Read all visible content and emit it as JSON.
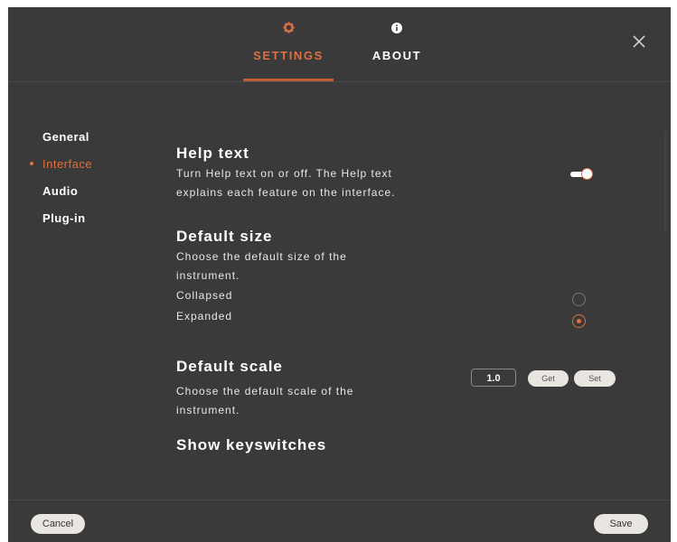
{
  "tabs": {
    "settings": {
      "label": "SETTINGS",
      "icon": "gear-icon"
    },
    "about": {
      "label": "ABOUT",
      "icon": "info-icon"
    }
  },
  "close_icon": "close-icon",
  "sidebar": {
    "items": [
      {
        "label": "General",
        "active": false
      },
      {
        "label": "Interface",
        "active": true
      },
      {
        "label": "Audio",
        "active": false
      },
      {
        "label": "Plug-in",
        "active": false
      }
    ]
  },
  "sections": {
    "help_text": {
      "title": "Help text",
      "desc_line1": "Turn Help text on or off. The Help text",
      "desc_line2": "explains each feature on the interface.",
      "enabled": true
    },
    "default_size": {
      "title": "Default size",
      "desc_line1": "Choose the default size of the",
      "desc_line2": "instrument.",
      "options": [
        "Collapsed",
        "Expanded"
      ],
      "selected": "Expanded"
    },
    "default_scale": {
      "title": "Default scale",
      "desc_line1": "Choose the default scale of the",
      "desc_line2": "instrument.",
      "value": "1.0",
      "get_label": "Get",
      "set_label": "Set"
    },
    "keyswitches": {
      "title": "Show keyswitches"
    }
  },
  "footer": {
    "cancel_label": "Cancel",
    "save_label": "Save"
  },
  "colors": {
    "accent": "#e0703f",
    "background": "#3a3a3a"
  }
}
